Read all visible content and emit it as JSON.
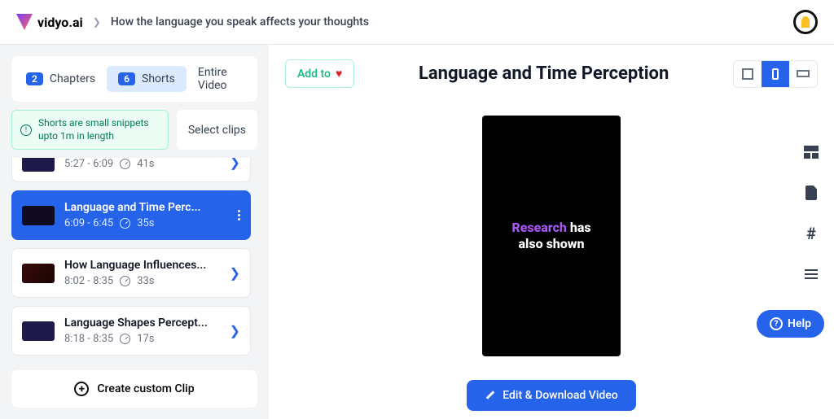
{
  "header": {
    "brand": "vidyo.ai",
    "breadcrumb": "How the language you speak affects your thoughts"
  },
  "sidebar": {
    "tabs": {
      "chapters_count": "2",
      "chapters": "Chapters",
      "shorts_count": "6",
      "shorts": "Shorts",
      "entire": "Entire Video"
    },
    "info": "Shorts are small snippets upto 1m in length",
    "select_clips": "Select clips",
    "clips": [
      {
        "title": "",
        "time": "5:27 - 6:09",
        "dur": "41s"
      },
      {
        "title": "Language and Time Perc...",
        "time": "6:09 - 6:45",
        "dur": "35s"
      },
      {
        "title": "How Language Influences...",
        "time": "8:02 - 8:35",
        "dur": "33s"
      },
      {
        "title": "Language Shapes Percept...",
        "time": "8:18 - 8:35",
        "dur": "17s"
      }
    ],
    "create": "Create custom Clip"
  },
  "content": {
    "add_to": "Add to",
    "title": "Language and Time Perception",
    "caption_hl": "Research",
    "caption_rest": " has also shown",
    "download": "Edit & Download Video"
  },
  "help": "Help"
}
